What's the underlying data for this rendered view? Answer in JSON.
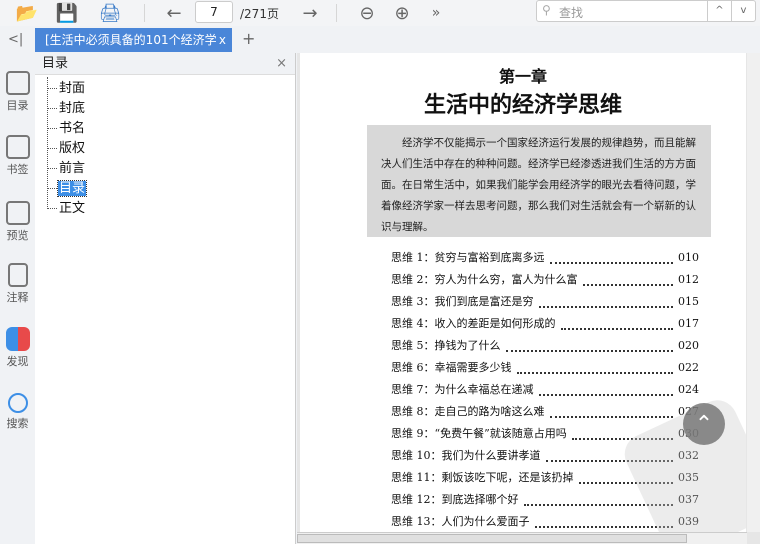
{
  "toolbar": {
    "icons": [
      "open-folder-icon",
      "save-icon",
      "print-icon",
      "arrow-left-icon",
      "arrow-right-icon",
      "zoom-out-icon",
      "zoom-in-icon",
      "more-icon"
    ],
    "page_current": "7",
    "page_total": "/271页",
    "search_placeholder": "查找",
    "search_prev": "^",
    "search_next": "v"
  },
  "tabs": {
    "collapse": "<|",
    "active": "[生活中必须具备的101个经济学",
    "close": "x",
    "add": "+"
  },
  "rail": [
    {
      "label": "目录",
      "icon": "list-icon"
    },
    {
      "label": "书签",
      "icon": "bookmark-icon"
    },
    {
      "label": "预览",
      "icon": "thumbnails-icon"
    },
    {
      "label": "注释",
      "icon": "annotation-icon"
    },
    {
      "label": "发现",
      "icon": "discover-icon"
    },
    {
      "label": "搜索",
      "icon": "search-icon"
    }
  ],
  "panel": {
    "title": "目录",
    "close": "×",
    "items": [
      "封面",
      "封底",
      "书名",
      "版权",
      "前言",
      "目录",
      "正文"
    ],
    "selected": "目录"
  },
  "page": {
    "chapter": "第一章",
    "title": "生活中的经济学思维",
    "abstract": "经济学不仅能揭示一个国家经济运行发展的规律趋势，而且能解决人们生活中存在的种种问题。经济学已经渗透进我们生活的方方面面。在日常生活中，如果我们能学会用经济学的眼光去看待问题，学着像经济学家一样去思考问题，那么我们对生活就会有一个崭新的认识与理解。",
    "toc": [
      {
        "t": "思维 1：贫穷与富裕到底离多远",
        "p": "010"
      },
      {
        "t": "思维 2：穷人为什么穷，富人为什么富",
        "p": "012"
      },
      {
        "t": "思维 3：我们到底是富还是穷",
        "p": "015"
      },
      {
        "t": "思维 4：收入的差距是如何形成的",
        "p": "017"
      },
      {
        "t": "思维 5：挣钱为了什么",
        "p": "020"
      },
      {
        "t": "思维 6：幸福需要多少钱",
        "p": "022"
      },
      {
        "t": "思维 7：为什么幸福总在递减",
        "p": "024"
      },
      {
        "t": "思维 8：走自己的路为啥这么难",
        "p": "027"
      },
      {
        "t": "思维 9：“免费午餐”就该随意占用吗",
        "p": "030"
      },
      {
        "t": "思维 10：我们为什么要讲孝道",
        "p": "032"
      },
      {
        "t": "思维 11：剩饭该吃下呢，还是该扔掉",
        "p": "035"
      },
      {
        "t": "思维 12：到底选择哪个好",
        "p": "037"
      },
      {
        "t": "思维 13：人们为什么爱面子",
        "p": "039"
      }
    ]
  },
  "colors": {
    "accent": "#4a86d8",
    "selected": "#3d8fe6"
  }
}
